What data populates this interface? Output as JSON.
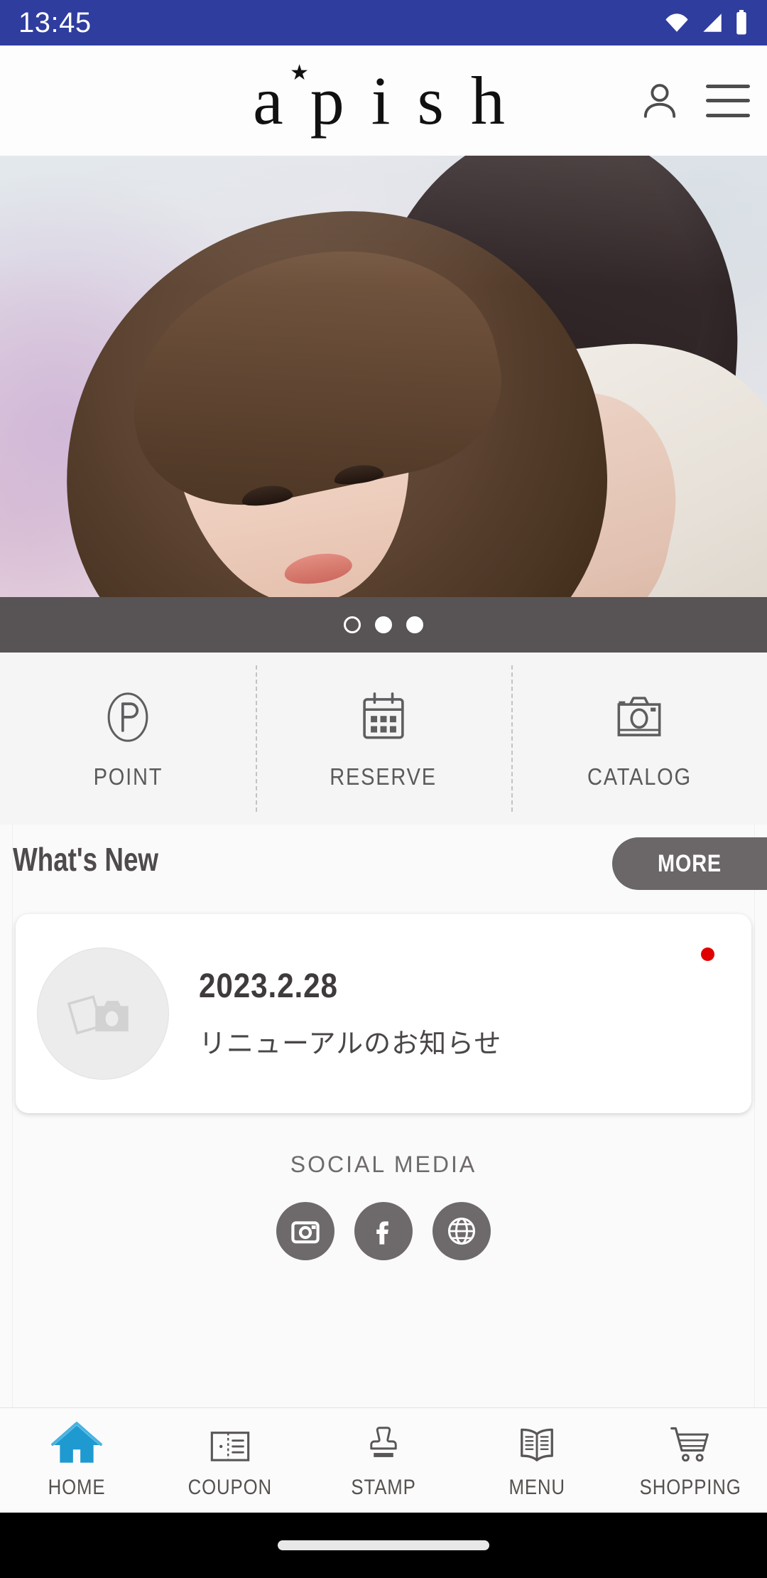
{
  "statusbar": {
    "time": "13:45",
    "icons": [
      "wifi-icon",
      "cellular-signal-icon",
      "battery-icon"
    ]
  },
  "header": {
    "logo_text": "a p i s h",
    "logo_brand": "apish",
    "logo_star": "★",
    "account_icon": "person-icon",
    "menu_icon": "hamburger-menu-icon"
  },
  "hero": {
    "alt": "two models with styled hair",
    "dots": [
      {
        "index": 1,
        "active": false
      },
      {
        "index": 2,
        "active": true
      },
      {
        "index": 3,
        "active": true
      }
    ]
  },
  "quick_actions": [
    {
      "label": "POINT",
      "icon": "point-p-circle-icon"
    },
    {
      "label": "RESERVE",
      "icon": "calendar-icon"
    },
    {
      "label": "CATALOG",
      "icon": "camera-icon"
    }
  ],
  "whats_new": {
    "title": "What's New",
    "more_label": "MORE",
    "items": [
      {
        "date": "2023.2.28",
        "title": "リニューアルのお知らせ",
        "thumb_icon": "photo-placeholder-icon",
        "unread": true
      }
    ]
  },
  "social": {
    "title": "SOCIAL MEDIA",
    "links": [
      {
        "name": "instagram-icon",
        "label": "Instagram"
      },
      {
        "name": "facebook-icon",
        "label": "Facebook"
      },
      {
        "name": "website-globe-icon",
        "label": "Website"
      }
    ]
  },
  "bottom_nav": {
    "active": "HOME",
    "items": [
      {
        "label": "HOME",
        "icon": "home-icon",
        "active": true
      },
      {
        "label": "COUPON",
        "icon": "coupon-ticket-icon",
        "active": false
      },
      {
        "label": "STAMP",
        "icon": "stamp-icon",
        "active": false
      },
      {
        "label": "MENU",
        "icon": "open-book-icon",
        "active": false
      },
      {
        "label": "SHOPPING",
        "icon": "shopping-cart-icon",
        "active": false
      }
    ]
  },
  "colors": {
    "statusbar_bg": "#2f3d9e",
    "accent_blue": "#1e9ad1",
    "gray_dark": "#585354",
    "gray_button": "#6b6668",
    "badge_red": "#e00000",
    "social_gray": "#6e6a6b"
  }
}
